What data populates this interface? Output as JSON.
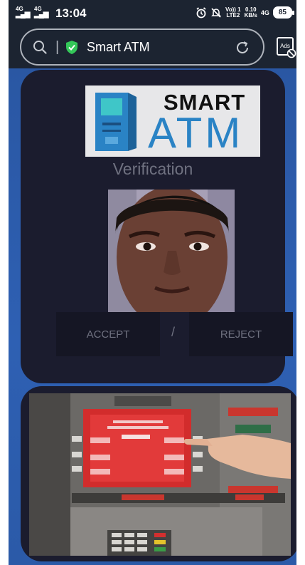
{
  "status_bar": {
    "sim1": "4G",
    "sim2": "4G",
    "time": "13:04",
    "volte_top": "Vo)) 1",
    "volte_bottom": "LTE2",
    "speed_value": "0.10",
    "speed_unit": "KB/s",
    "network": "4G",
    "battery": "85"
  },
  "browser": {
    "site_title": "Smart ATM",
    "ads_label": "Ads"
  },
  "logo": {
    "word1": "SMART",
    "word2": "ATM"
  },
  "verification": {
    "heading": "Verification",
    "accept_label": "ACCEPT",
    "separator": "/",
    "reject_label": "REJECT"
  },
  "colors": {
    "background": "#1c2431",
    "card": "#1b1c2e",
    "page_blue": "#2e60b3",
    "shield_green": "#34c759",
    "logo_blue": "#2a83c5"
  }
}
